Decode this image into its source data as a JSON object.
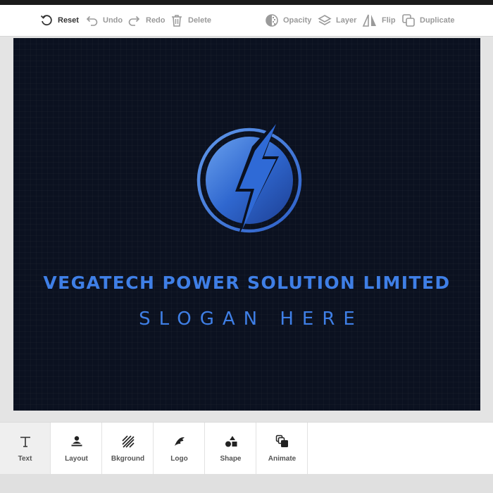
{
  "toolbar": {
    "reset": "Reset",
    "undo": "Undo",
    "redo": "Redo",
    "delete": "Delete",
    "opacity": "Opacity",
    "layer": "Layer",
    "flip": "Flip",
    "duplicate": "Duplicate",
    "icons": [
      "reset-icon",
      "undo-icon",
      "redo-icon",
      "trash-icon",
      "opacity-icon",
      "layers-icon",
      "flip-icon",
      "duplicate-icon"
    ]
  },
  "canvas": {
    "company_name": "VEGATECH POWER SOLUTION LIMITED",
    "slogan": "SLOGAN HERE",
    "background_color": "#0b1120",
    "text_color": "#3f7fe6",
    "logo_icon": "lightning-bolt-circle"
  },
  "tabs": [
    {
      "label": "Text",
      "icon": "text-icon"
    },
    {
      "label": "Layout",
      "icon": "layout-icon"
    },
    {
      "label": "Bkground",
      "icon": "background-icon"
    },
    {
      "label": "Logo",
      "icon": "logo-icon"
    },
    {
      "label": "Shape",
      "icon": "shape-icon"
    },
    {
      "label": "Animate",
      "icon": "animate-icon"
    }
  ]
}
